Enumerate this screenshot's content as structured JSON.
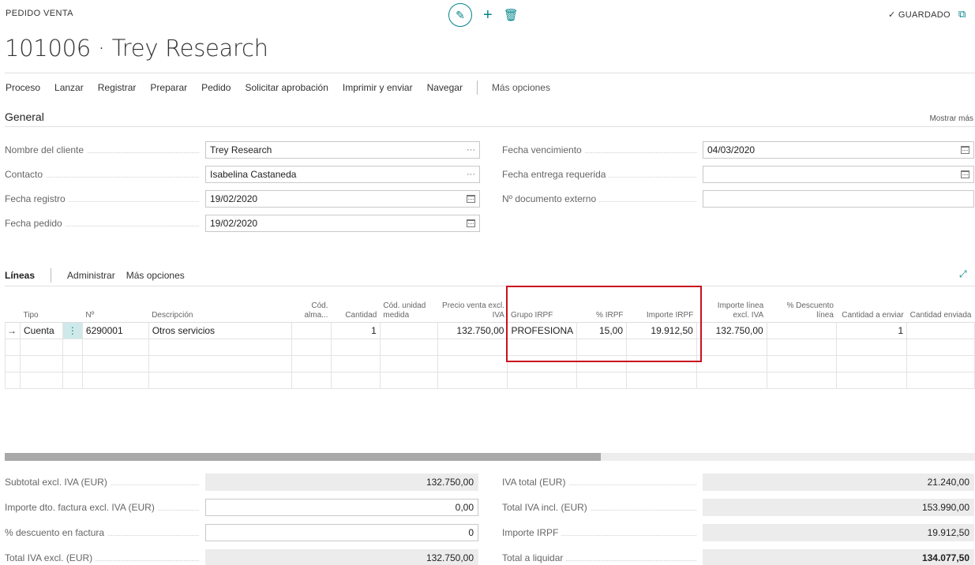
{
  "header": {
    "doc_type": "PEDIDO VENTA",
    "saved_status": "GUARDADO",
    "title": "101006 · Trey Research"
  },
  "actions": [
    "Proceso",
    "Lanzar",
    "Registrar",
    "Preparar",
    "Pedido",
    "Solicitar aprobación",
    "Imprimir y enviar",
    "Navegar"
  ],
  "actions_more": "Más opciones",
  "general": {
    "title": "General",
    "show_more": "Mostrar más",
    "left_fields": [
      {
        "label": "Nombre del cliente",
        "value": "Trey Research",
        "suffix": "···"
      },
      {
        "label": "Contacto",
        "value": "Isabelina Castaneda",
        "suffix": "···"
      },
      {
        "label": "Fecha registro",
        "value": "19/02/2020",
        "suffix": "calendar"
      },
      {
        "label": "Fecha pedido",
        "value": "19/02/2020",
        "suffix": "calendar"
      }
    ],
    "right_fields": [
      {
        "label": "Fecha vencimiento",
        "value": "04/03/2020",
        "suffix": "calendar"
      },
      {
        "label": "Fecha entrega requerida",
        "value": "",
        "suffix": "calendar"
      },
      {
        "label": "Nº documento externo",
        "value": "",
        "suffix": ""
      }
    ]
  },
  "lines": {
    "title": "Líneas",
    "manage": "Administrar",
    "more": "Más opciones",
    "columns": [
      {
        "label": "Tipo",
        "align": "l"
      },
      {
        "label": "",
        "align": "l"
      },
      {
        "label": "Nº",
        "align": "l"
      },
      {
        "label": "Descripción",
        "align": "l"
      },
      {
        "label": "Cód. alma...",
        "align": "r"
      },
      {
        "label": "Cantidad",
        "align": "r"
      },
      {
        "label": "Cód. unidad medida",
        "align": "l"
      },
      {
        "label": "Precio venta excl. IVA",
        "align": "r"
      },
      {
        "label": "Grupo IRPF",
        "align": "l"
      },
      {
        "label": "% IRPF",
        "align": "r"
      },
      {
        "label": "Importe IRPF",
        "align": "r"
      },
      {
        "label": "Importe línea excl. IVA",
        "align": "r"
      },
      {
        "label": "% Descuento línea",
        "align": "r"
      },
      {
        "label": "Cantidad a enviar",
        "align": "r"
      },
      {
        "label": "Cantidad enviada",
        "align": "r"
      }
    ],
    "rows": [
      {
        "tipo": "Cuenta",
        "no": "6290001",
        "descripcion": "Otros servicios",
        "alm": "",
        "cantidad": "1",
        "unidad": "",
        "precio": "132.750,00",
        "grupo_irpf": "PROFESIONA",
        "pct_irpf": "15,00",
        "importe_irpf": "19.912,50",
        "importe_linea": "132.750,00",
        "descuento": "",
        "cant_enviar": "1",
        "cant_enviada": ""
      }
    ]
  },
  "totals": {
    "left": [
      {
        "label": "Subtotal excl. IVA (EUR)",
        "value": "132.750,00"
      },
      {
        "label": "Importe dto. factura excl. IVA (EUR)",
        "value": "0,00"
      },
      {
        "label": "% descuento en factura",
        "value": "0"
      },
      {
        "label": "Total IVA excl. (EUR)",
        "value": "132.750,00"
      }
    ],
    "right": [
      {
        "label": "IVA total (EUR)",
        "value": "21.240,00"
      },
      {
        "label": "Total IVA incl. (EUR)",
        "value": "153.990,00"
      },
      {
        "label": "Importe IRPF",
        "value": "19.912,50"
      },
      {
        "label": "Total a liquidar",
        "value": "134.077,50"
      }
    ]
  }
}
